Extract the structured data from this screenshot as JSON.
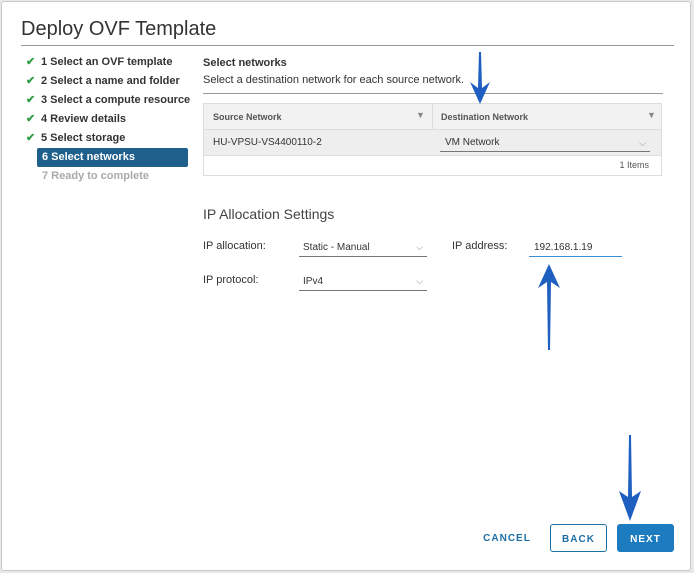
{
  "window": {
    "title": "Deploy OVF Template"
  },
  "steps": [
    {
      "label": "1 Select an OVF template",
      "state": "done"
    },
    {
      "label": "2 Select a name and folder",
      "state": "done"
    },
    {
      "label": "3 Select a compute resource",
      "state": "done"
    },
    {
      "label": "4 Review details",
      "state": "done"
    },
    {
      "label": "5 Select storage",
      "state": "done"
    },
    {
      "label": "6 Select networks",
      "state": "active"
    },
    {
      "label": "7 Ready to complete",
      "state": "disabled"
    }
  ],
  "networks": {
    "heading": "Select networks",
    "description": "Select a destination network for each source network.",
    "columns": {
      "source": "Source Network",
      "destination": "Destination Network"
    },
    "rows": [
      {
        "source": "HU-VPSU-VS4400110-2",
        "destination": "VM Network"
      }
    ],
    "items_count": "1 Items"
  },
  "ip_settings": {
    "title": "IP Allocation Settings",
    "allocation_label": "IP allocation:",
    "allocation_value": "Static - Manual",
    "protocol_label": "IP protocol:",
    "protocol_value": "IPv4",
    "address_label": "IP address:",
    "address_value": "192.168.1.19"
  },
  "buttons": {
    "cancel": "CANCEL",
    "back": "BACK",
    "next": "NEXT"
  },
  "colors": {
    "accent": "#1d7bbf",
    "active_step": "#1e5f8c",
    "check": "#2f9e44",
    "annotation_arrow": "#1f5fbf"
  },
  "icons": {
    "check": "check-icon",
    "filter": "filter-icon",
    "chevron": "chevron-down-icon",
    "annotation": "arrow-annotation-icon"
  }
}
